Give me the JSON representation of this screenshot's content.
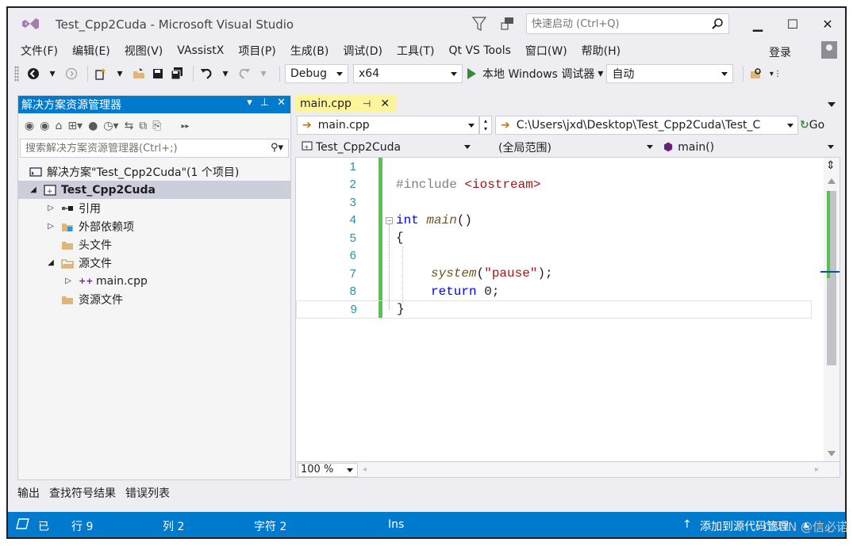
{
  "window": {
    "title": "Test_Cpp2Cuda - Microsoft Visual Studio",
    "quick_launch_placeholder": "快速启动 (Ctrl+Q)",
    "minimize": "▁",
    "maximize": "☐",
    "close": "✕"
  },
  "menu": {
    "items": [
      "文件(F)",
      "编辑(E)",
      "视图(V)",
      "VAssistX",
      "项目(P)",
      "生成(B)",
      "调试(D)",
      "工具(T)",
      "Qt VS Tools",
      "窗口(W)",
      "帮助(H)"
    ],
    "login": "登录"
  },
  "toolbar": {
    "configuration": "Debug",
    "platform": "x64",
    "debugger": "本地 Windows 调试器",
    "debugger_dropdown": "▾",
    "launch_mode": "自动"
  },
  "solution_explorer": {
    "title": "解决方案资源管理器",
    "search_placeholder": "搜索解决方案资源管理器(Ctrl+;)",
    "tree": [
      {
        "label": "解决方案\"Test_Cpp2Cuda\"(1 个项目)",
        "expander": ""
      },
      {
        "label": "Test_Cpp2Cuda",
        "expander": "◢"
      },
      {
        "label": "引用",
        "expander": "▷"
      },
      {
        "label": "外部依赖项",
        "expander": "▷"
      },
      {
        "label": "头文件",
        "expander": ""
      },
      {
        "label": "源文件",
        "expander": "◢"
      },
      {
        "label": "main.cpp",
        "expander": "▷"
      },
      {
        "label": "资源文件",
        "expander": ""
      }
    ]
  },
  "bottom_tabs": [
    "输出",
    "查找符号结果",
    "错误列表"
  ],
  "editor": {
    "tab_label": "main.cpp",
    "nav_file": "main.cpp",
    "nav_path": "C:\\Users\\jxd\\Desktop\\Test_Cpp2Cuda\\Test_C",
    "go_label": "Go",
    "nav_project": "Test_Cpp2Cuda",
    "nav_scope": "(全局范围)",
    "nav_member": "main()",
    "zoom": "100 %",
    "line_numbers": [
      "1",
      "2",
      "3",
      "4",
      "5",
      "6",
      "7",
      "8",
      "9"
    ],
    "code": {
      "include_directive": "#include",
      "include_header": "<iostream>",
      "int_kw": "int",
      "main_fn": "main",
      "main_parens": "()",
      "open_brace": "{",
      "system_fn": "system",
      "system_open": "(",
      "pause_str": "\"pause\"",
      "system_close": ");",
      "return_kw": "return",
      "return_val": " 0;",
      "close_brace": "}"
    }
  },
  "status_bar": {
    "ready": "已",
    "line": "行 9",
    "column": "列 2",
    "char": "字符 2",
    "mode": "Ins",
    "source_control": "添加到源代码管理",
    "watermark": "CSDN @信必诺"
  },
  "colors": {
    "accent": "#007acc",
    "tab_active": "#fef49c",
    "change_bar": "#57c250",
    "keyword": "#0000ff",
    "string": "#a31515"
  }
}
